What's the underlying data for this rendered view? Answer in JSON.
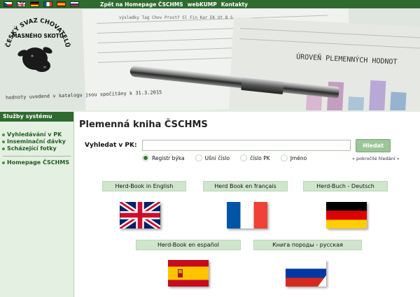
{
  "topbar": {
    "flags": [
      "cz-flag",
      "uk-flag",
      "de-flag",
      "fr-flag",
      "es-flag",
      "ru-flag"
    ],
    "links": [
      {
        "label": "Zpět na Homepage ČSCHMS"
      },
      {
        "label": "webKUMP"
      },
      {
        "label": "Kontakty"
      }
    ]
  },
  "header": {
    "logo_text": "ČESKÝ SVAZ CHOVATELŮ MASNÉHO SKOTU",
    "photo_caption": "ÚROVEŇ PLEMENNÝCH HODNOT",
    "photo_catalog_line": "hodnoty uvedené v katalogu jsou spočítány k 31.3.2015",
    "photo_table_text": "výsledky  Tag   Chov  Prostř   Sl  Fin  Kar  EK  Ut  B  S"
  },
  "sidebar": {
    "heading": "Služby systému",
    "items": [
      {
        "label": "Vyhledávání v PK"
      },
      {
        "label": "Inseminační dávky"
      },
      {
        "label": "Scházející fotky"
      }
    ],
    "extra_items": [
      {
        "label": "Homepage ČSCHMS"
      }
    ]
  },
  "main": {
    "title": "Plemenná kniha ČSCHMS",
    "search": {
      "label": "Vyhledat v PK:",
      "value": "",
      "placeholder": "",
      "button": "Hledat",
      "advanced": "» pokročilé hledání »",
      "options": [
        {
          "label": "Registr býka",
          "selected": true
        },
        {
          "label": "Ušní číslo",
          "selected": false
        },
        {
          "label": "číslo PK",
          "selected": false
        },
        {
          "label": "Jméno",
          "selected": false
        }
      ]
    },
    "languages": [
      {
        "label": "Herd-Book in English",
        "flag": "uk-flag"
      },
      {
        "label": "Herd Book en français",
        "flag": "fr-flag"
      },
      {
        "label": "Herd-Buch - Deutsch",
        "flag": "de-flag"
      },
      {
        "label": "Herd-Book en español",
        "flag": "es-flag"
      },
      {
        "label": "Книга породы - русская",
        "flag": "ru-flag"
      }
    ]
  },
  "colors": {
    "brand_green": "#2f6b2f",
    "sidebar_bg": "#e4f0e2",
    "button_green": "#9cc699",
    "lang_button_bg": "#cfe6cc"
  }
}
